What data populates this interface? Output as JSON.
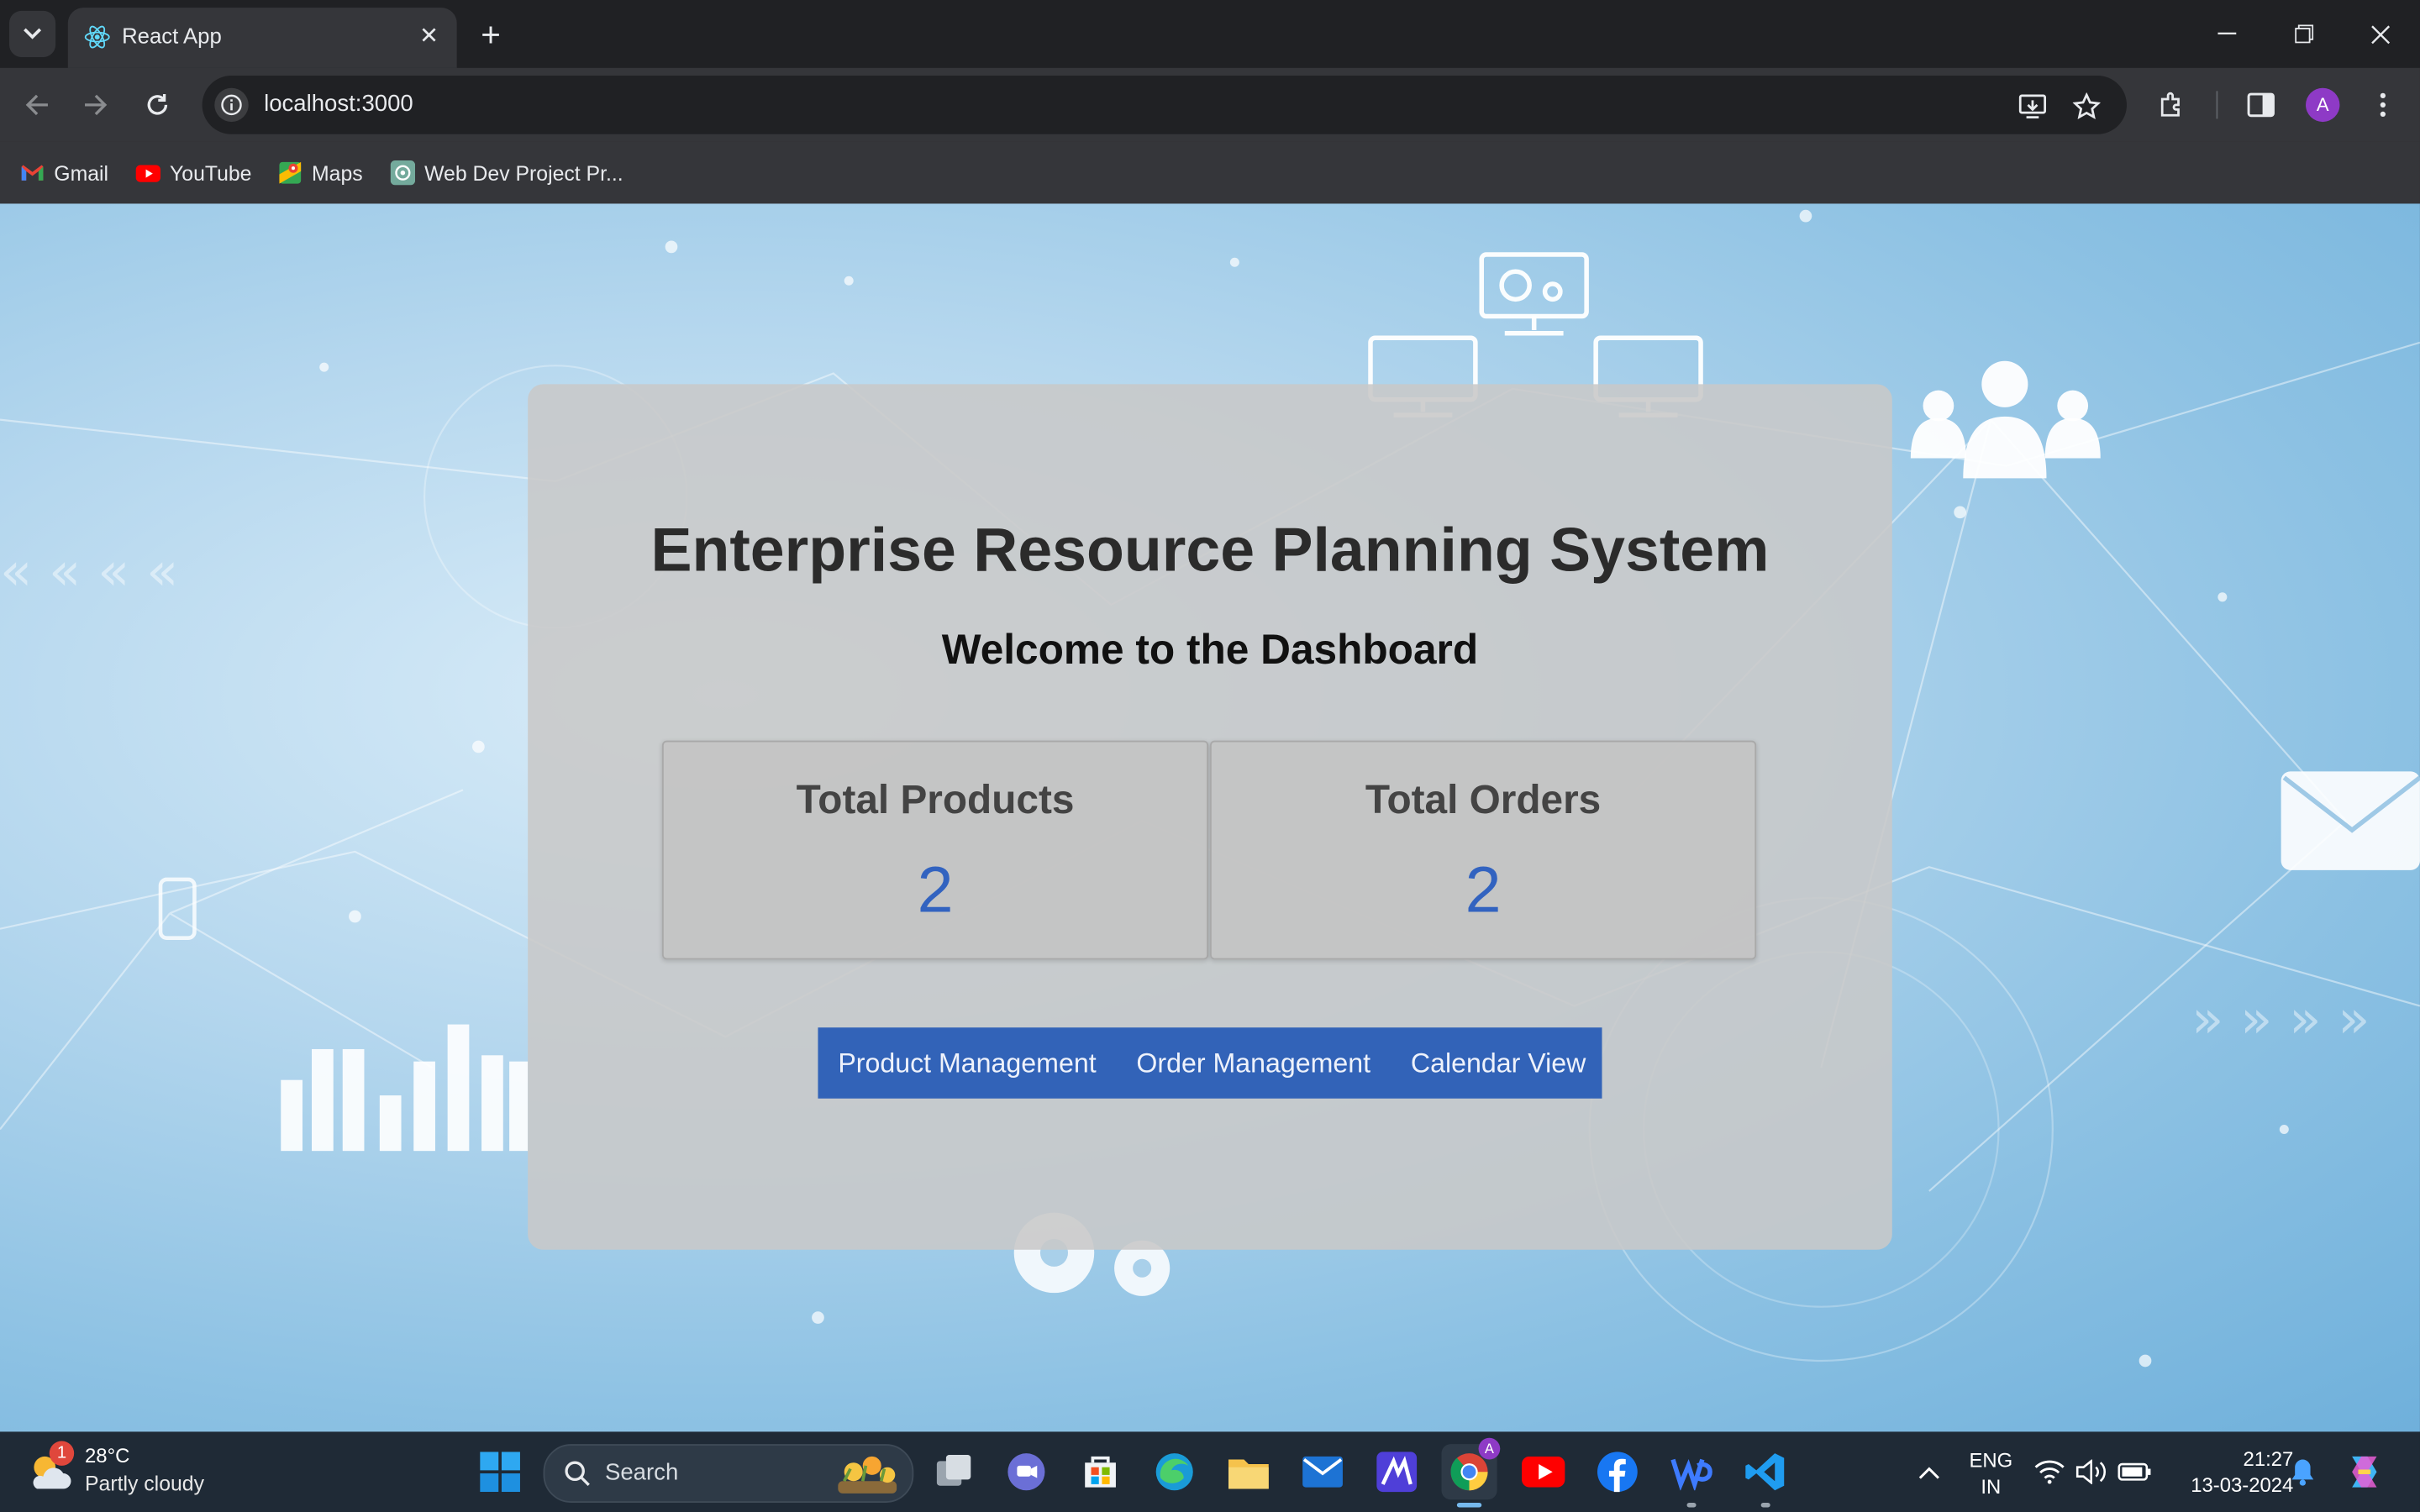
{
  "browser": {
    "tab_title": "React App",
    "url": "localhost:3000",
    "profile_initial": "A",
    "bookmarks": [
      {
        "label": "Gmail",
        "icon": "gmail-icon"
      },
      {
        "label": "YouTube",
        "icon": "youtube-icon"
      },
      {
        "label": "Maps",
        "icon": "maps-icon"
      },
      {
        "label": "Web Dev Project Pr...",
        "icon": "chatgpt-icon"
      }
    ]
  },
  "dashboard": {
    "title": "Enterprise Resource Planning System",
    "subtitle": "Welcome to the Dashboard",
    "stats": [
      {
        "label": "Total Products",
        "value": "2"
      },
      {
        "label": "Total Orders",
        "value": "2"
      }
    ],
    "nav": [
      "Product Management",
      "Order Management",
      "Calendar View"
    ],
    "colors": {
      "accent": "#3263b8",
      "value_text": "#3263c0"
    }
  },
  "taskbar": {
    "weather_temp": "28°C",
    "weather_desc": "Partly cloudy",
    "weather_badge": "1",
    "search_placeholder": "Search",
    "language": "ENG",
    "region": "IN",
    "time": "21:27",
    "date": "13-03-2024"
  }
}
